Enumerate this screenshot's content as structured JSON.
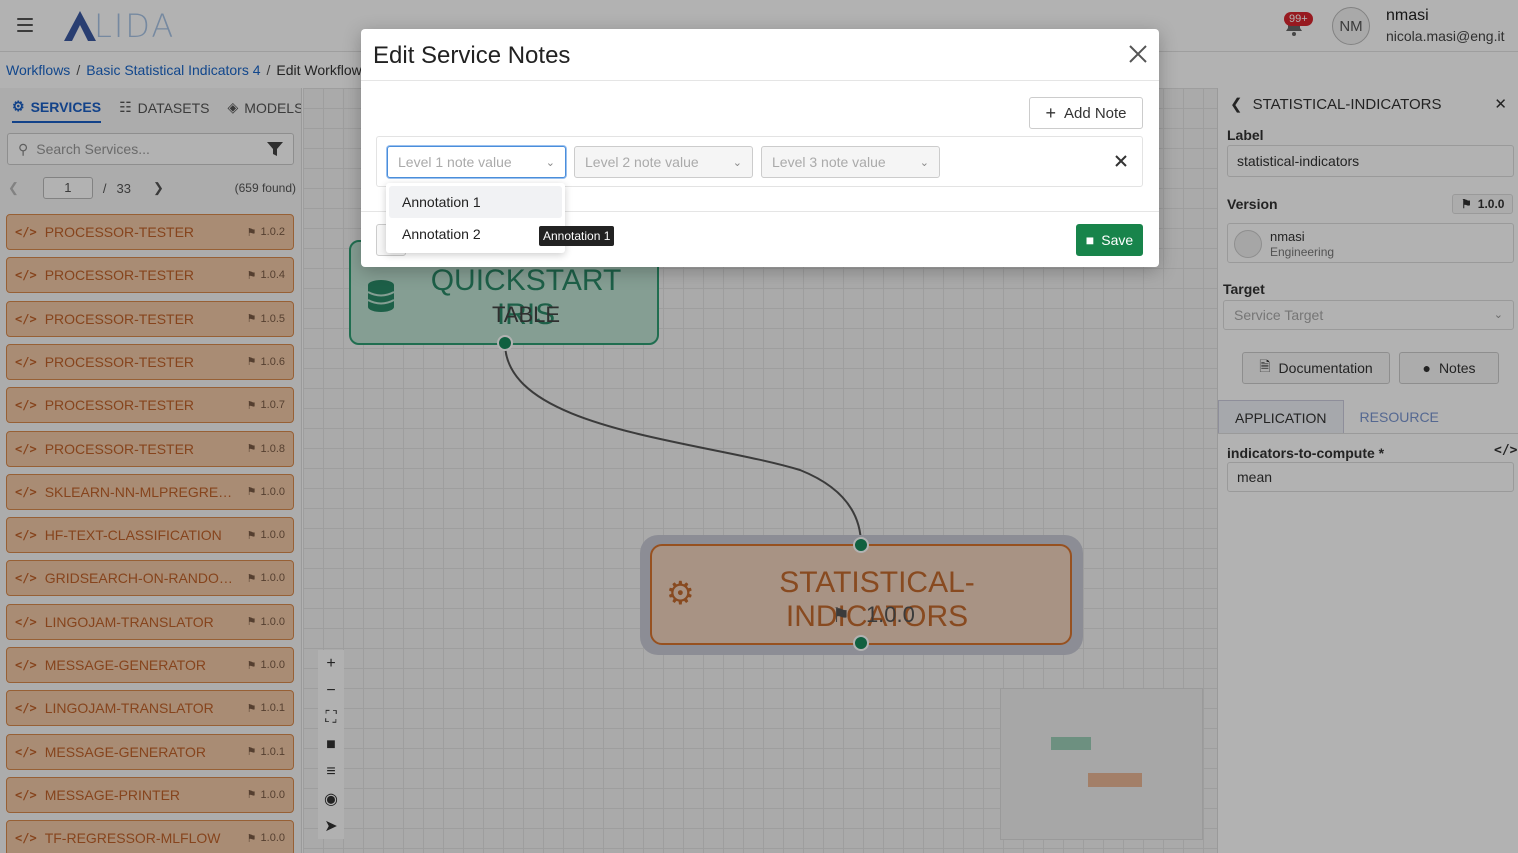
{
  "header": {
    "logo_text": "LIDA",
    "notification_badge": "99+",
    "avatar_initials": "NM",
    "user_name": "nmasi",
    "user_email": "nicola.masi@eng.it"
  },
  "breadcrumb": [
    {
      "label": "Workflows"
    },
    {
      "label": "Basic Statistical Indicators 4"
    },
    {
      "label": "Edit Workflow"
    }
  ],
  "left_panel": {
    "tabs": [
      {
        "label": "SERVICES",
        "icon": "services-icon",
        "active": true
      },
      {
        "label": "DATASETS",
        "icon": "database-icon",
        "active": false
      },
      {
        "label": "MODELS",
        "icon": "models-icon",
        "active": false
      }
    ],
    "search_placeholder": "Search Services...",
    "page_current": "1",
    "page_total": "33",
    "found_text": "(659 found)",
    "services": [
      {
        "name": "PROCESSOR-TESTER",
        "version": "1.0.2"
      },
      {
        "name": "PROCESSOR-TESTER",
        "version": "1.0.4"
      },
      {
        "name": "PROCESSOR-TESTER",
        "version": "1.0.5"
      },
      {
        "name": "PROCESSOR-TESTER",
        "version": "1.0.6"
      },
      {
        "name": "PROCESSOR-TESTER",
        "version": "1.0.7"
      },
      {
        "name": "PROCESSOR-TESTER",
        "version": "1.0.8"
      },
      {
        "name": "SKLEARN-NN-MLPREGRESSOR",
        "version": "1.0.0"
      },
      {
        "name": "HF-TEXT-CLASSIFICATION",
        "version": "1.0.0"
      },
      {
        "name": "GRIDSEARCH-ON-RANDOM...",
        "version": "1.0.0"
      },
      {
        "name": "LINGOJAM-TRANSLATOR",
        "version": "1.0.0"
      },
      {
        "name": "MESSAGE-GENERATOR",
        "version": "1.0.0"
      },
      {
        "name": "LINGOJAM-TRANSLATOR",
        "version": "1.0.1"
      },
      {
        "name": "MESSAGE-GENERATOR",
        "version": "1.0.1"
      },
      {
        "name": "MESSAGE-PRINTER",
        "version": "1.0.0"
      },
      {
        "name": "TF-REGRESSOR-MLFLOW",
        "version": "1.0.0"
      }
    ]
  },
  "canvas": {
    "node_dataset": {
      "title": "QUICKSTART IRIS",
      "subtitle": "TABLE"
    },
    "node_service": {
      "title": "STATISTICAL-INDICATORS",
      "version": "1.0.0"
    }
  },
  "right_panel": {
    "title": "STATISTICAL-INDICATORS",
    "label_heading": "Label",
    "label_value": "statistical-indicators",
    "version_heading": "Version",
    "version_value": "1.0.0",
    "owner_name": "nmasi",
    "owner_team": "Engineering",
    "target_heading": "Target",
    "target_placeholder": "Service Target",
    "documentation_label": "Documentation",
    "notes_label": "Notes",
    "tab_application": "APPLICATION",
    "tab_resource": "RESOURCE",
    "param_label": "indicators-to-compute *",
    "param_value": "mean"
  },
  "modal": {
    "title": "Edit Service Notes",
    "add_note_label": "Add Note",
    "level1_placeholder": "Level 1 note value",
    "level2_placeholder": "Level 2 note value",
    "level3_placeholder": "Level 3 note value",
    "save_label": "Save",
    "options": [
      "Annotation 1",
      "Annotation 2"
    ],
    "tooltip": "Annotation 1"
  },
  "colors": {
    "brand_blue": "#1a5fc4",
    "service_orange": "#d9742f",
    "dataset_green": "#2e9e73",
    "save_green": "#18844b"
  }
}
